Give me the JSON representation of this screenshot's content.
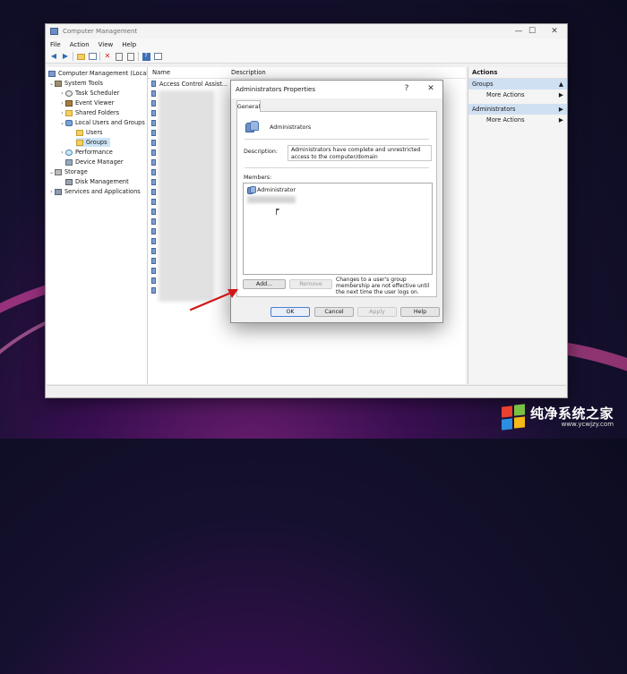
{
  "window": {
    "title": "Computer Management",
    "minimize": "—",
    "maximize": "☐",
    "close": "✕"
  },
  "menu": [
    "File",
    "Action",
    "View",
    "Help"
  ],
  "tree": {
    "root": "Computer Management (Local",
    "system_tools": "System Tools",
    "task_scheduler": "Task Scheduler",
    "event_viewer": "Event Viewer",
    "shared_folders": "Shared Folders",
    "local_users_groups": "Local Users and Groups",
    "users": "Users",
    "groups": "Groups",
    "performance": "Performance",
    "device_manager": "Device Manager",
    "storage": "Storage",
    "disk_management": "Disk Management",
    "services_apps": "Services and Applications"
  },
  "list": {
    "col_name": "Name",
    "col_description": "Description",
    "first_row": "Access Control Assist..."
  },
  "actions": {
    "title": "Actions",
    "section1": "Groups",
    "section1_item": "More Actions",
    "section2": "Administrators",
    "section2_item": "More Actions"
  },
  "dialog": {
    "title": "Administrators Properties",
    "help_button": "?",
    "close_button": "✕",
    "tab_general": "General",
    "group_name": "Administrators",
    "description_label": "Description:",
    "description_value": "Administrators have complete and unrestricted access to the computer/domain",
    "members_label": "Members:",
    "members": [
      "Administrator"
    ],
    "add_button": "Add...",
    "remove_button": "Remove",
    "note": "Changes to a user's group membership are not effective until the next time the user logs on.",
    "ok": "OK",
    "cancel": "Cancel",
    "apply": "Apply",
    "help": "Help"
  },
  "watermark": {
    "main": "纯净系统之家",
    "sub": "www.ycwjzy.com"
  },
  "colors": {
    "accent_selection": "#cce4f7",
    "action_section_bg": "#cfe0f3",
    "arrow_red": "#d01818"
  }
}
